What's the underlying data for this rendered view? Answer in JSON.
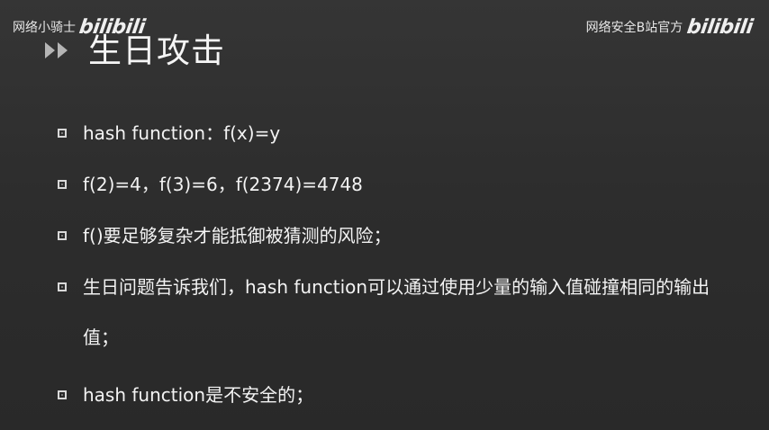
{
  "watermarks": {
    "left_text": "网络小骑士",
    "left_logo": "bilibili",
    "right_text": "网络安全B站官方",
    "right_logo": "bilibili"
  },
  "title": {
    "icon": "double-chevron-right-icon",
    "text": "生日攻击"
  },
  "bullets": [
    {
      "text": "hash function：f(x)=y"
    },
    {
      "text": "f(2)=4，f(3)=6，f(2374)=4748"
    },
    {
      "text": "f()要足够复杂才能抵御被猜测的风险；"
    },
    {
      "text": "生日问题告诉我们，hash function可以通过使用少量的输入值碰撞相同的输出值；"
    },
    {
      "text": "hash function是不安全的；"
    }
  ],
  "colors": {
    "background": "#2f2f2f",
    "text": "#f2f2f2",
    "bullet_border": "#d9d9d9",
    "arrow_fill": "#b5b5b5"
  }
}
